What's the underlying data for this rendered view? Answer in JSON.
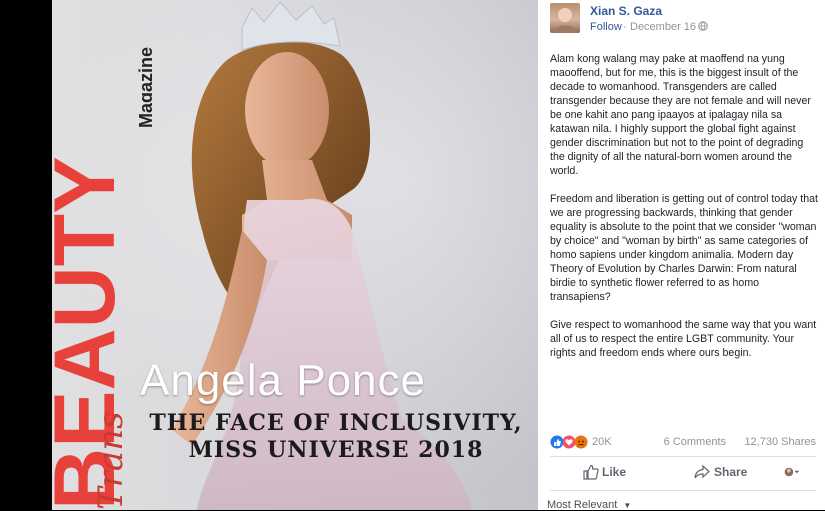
{
  "magazine": {
    "title_beauty": "BEAUTY",
    "title_magazine": "Magazine",
    "title_trans": "Trans",
    "cover_name": "Angela Ponce",
    "cover_tagline_1": "THE FACE OF INCLUSIVITY,",
    "cover_tagline_2": "MISS UNIVERSE 2018",
    "accent_color": "#e8403a"
  },
  "post": {
    "author": "Xian S. Gaza",
    "follow_label": "Follow",
    "separator": "·",
    "date": "December 16",
    "paragraphs": [
      "Alam kong walang may pake at maoffend na yung maooffend, but for me, this is the biggest insult of the decade to womanhood. Transgenders are called transgender because they are not female and will never be one kahit ano pang ipaayos at ipalagay nila sa katawan nila. I highly support the global fight against gender discrimination but not to the point of degrading the dignity of all the natural-born women around the world.",
      "Freedom and liberation is getting out of control today that we are progressing backwards, thinking that gender equality is absolute to the point that we consider \"woman by choice\" and \"woman by birth\" as same categories of homo sapiens under kingdom animalia. Modern day Theory of Evolution by Charles Darwin: From natural birdie to synthetic flower referred to as homo transapiens?",
      "Give respect to womanhood the same way that you want all of us to respect the entire LGBT community. Your rights and freedom ends where ours begin."
    ],
    "reaction_count": "20K",
    "comments": "6 Comments",
    "shares": "12,730 Shares",
    "like_label": "Like",
    "share_label": "Share",
    "sort_label": "Most Relevant"
  },
  "colors": {
    "link_blue": "#365899",
    "like_blue": "#2078f4",
    "love_red": "#f25268",
    "angry_orange": "#e9710f"
  }
}
